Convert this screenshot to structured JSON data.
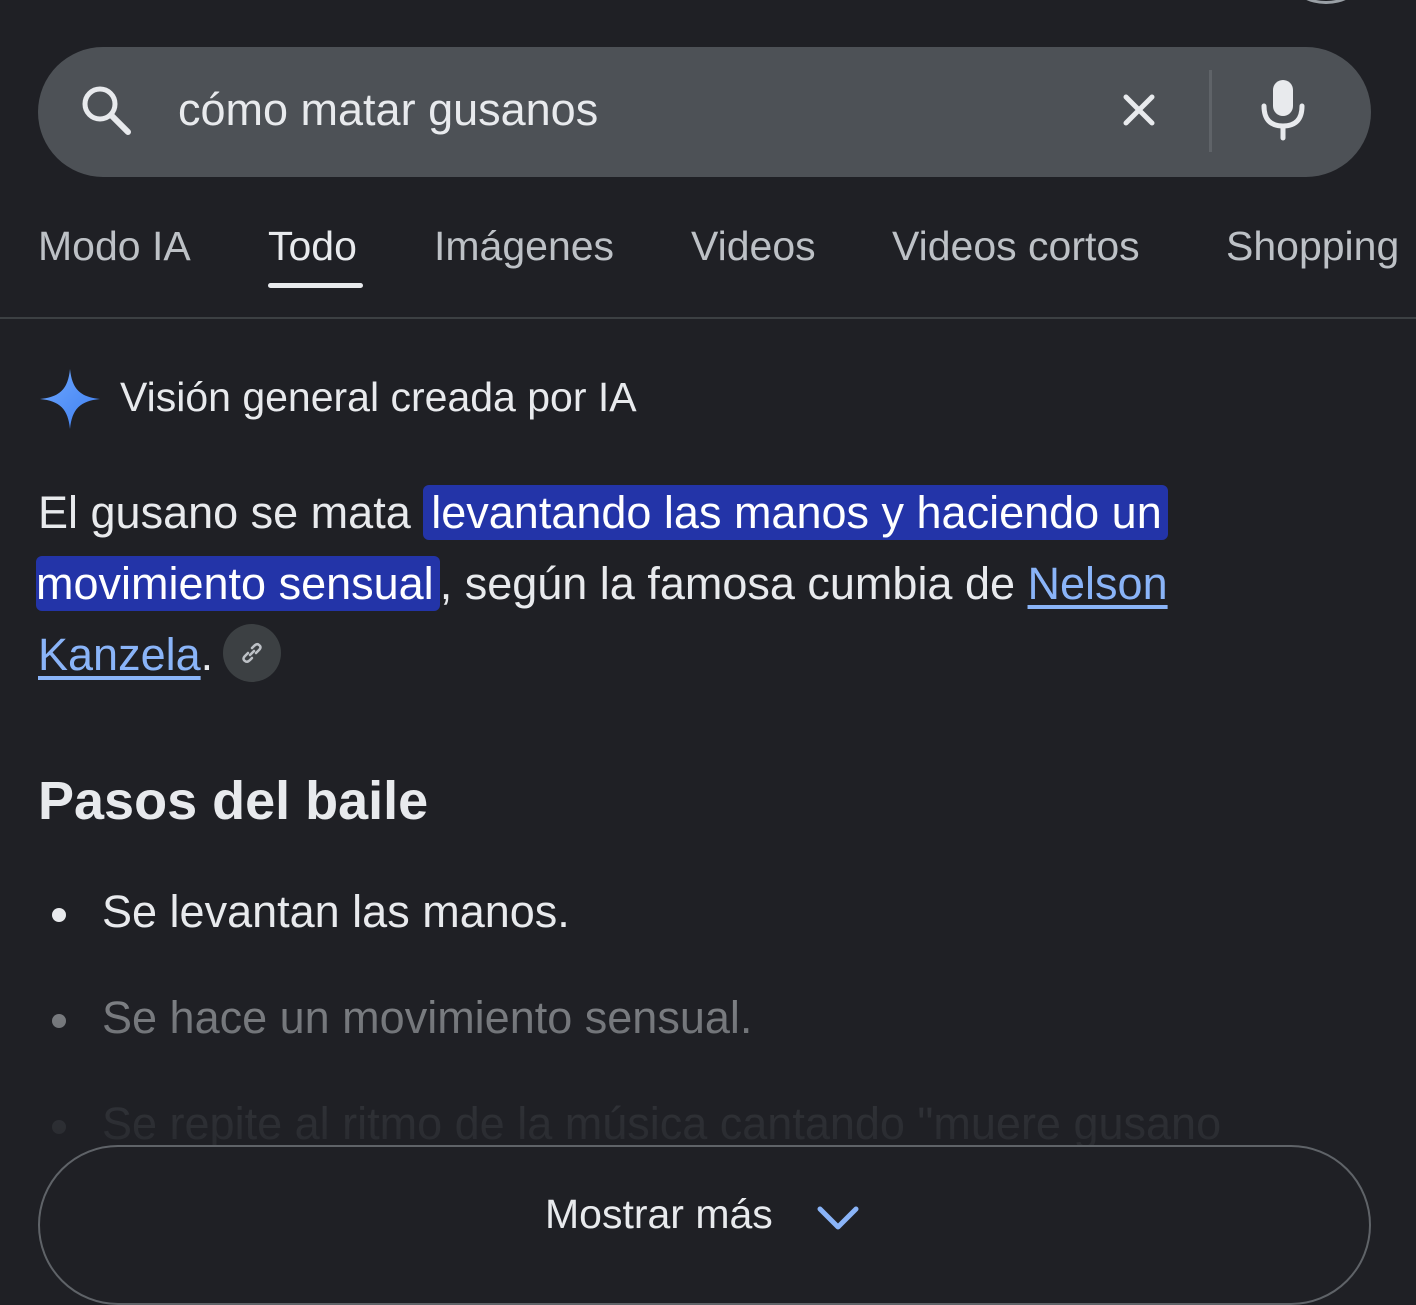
{
  "search": {
    "query": "cómo matar gusanos",
    "icon": "search-icon",
    "clear_icon": "close-icon",
    "voice_icon": "mic-icon"
  },
  "tabs": [
    {
      "label": "Modo IA",
      "active": false
    },
    {
      "label": "Todo",
      "active": true
    },
    {
      "label": "Imágenes",
      "active": false
    },
    {
      "label": "Videos",
      "active": false
    },
    {
      "label": "Videos cortos",
      "active": false
    },
    {
      "label": "Shopping",
      "active": false
    }
  ],
  "ai_overview": {
    "title": "Visión general creada por IA",
    "icon": "sparkle-icon",
    "answer": {
      "prefix": "El gusano se mata ",
      "highlight_line1": "levantando las manos y haciendo un",
      "highlight_line2": "movimiento sensual",
      "middle": ", según la famosa cumbia de ",
      "link_part1": "Nelson",
      "link_part2": "Kanzela",
      "suffix": "."
    },
    "source_icon": "link-icon"
  },
  "section": {
    "heading": "Pasos del baile",
    "steps": [
      "Se levantan las manos.",
      "Se hace un movimiento sensual.",
      "Se repite al ritmo de la música cantando \"muere gusano"
    ]
  },
  "show_more": {
    "label": "Mostrar más",
    "icon": "chevron-down-icon"
  },
  "colors": {
    "background": "#1f2025",
    "search_bar": "#4d5156",
    "highlight": "#2334a8",
    "link": "#8ab4f8",
    "text": "#e8eaed",
    "sparkle": "#4f8ff5"
  }
}
